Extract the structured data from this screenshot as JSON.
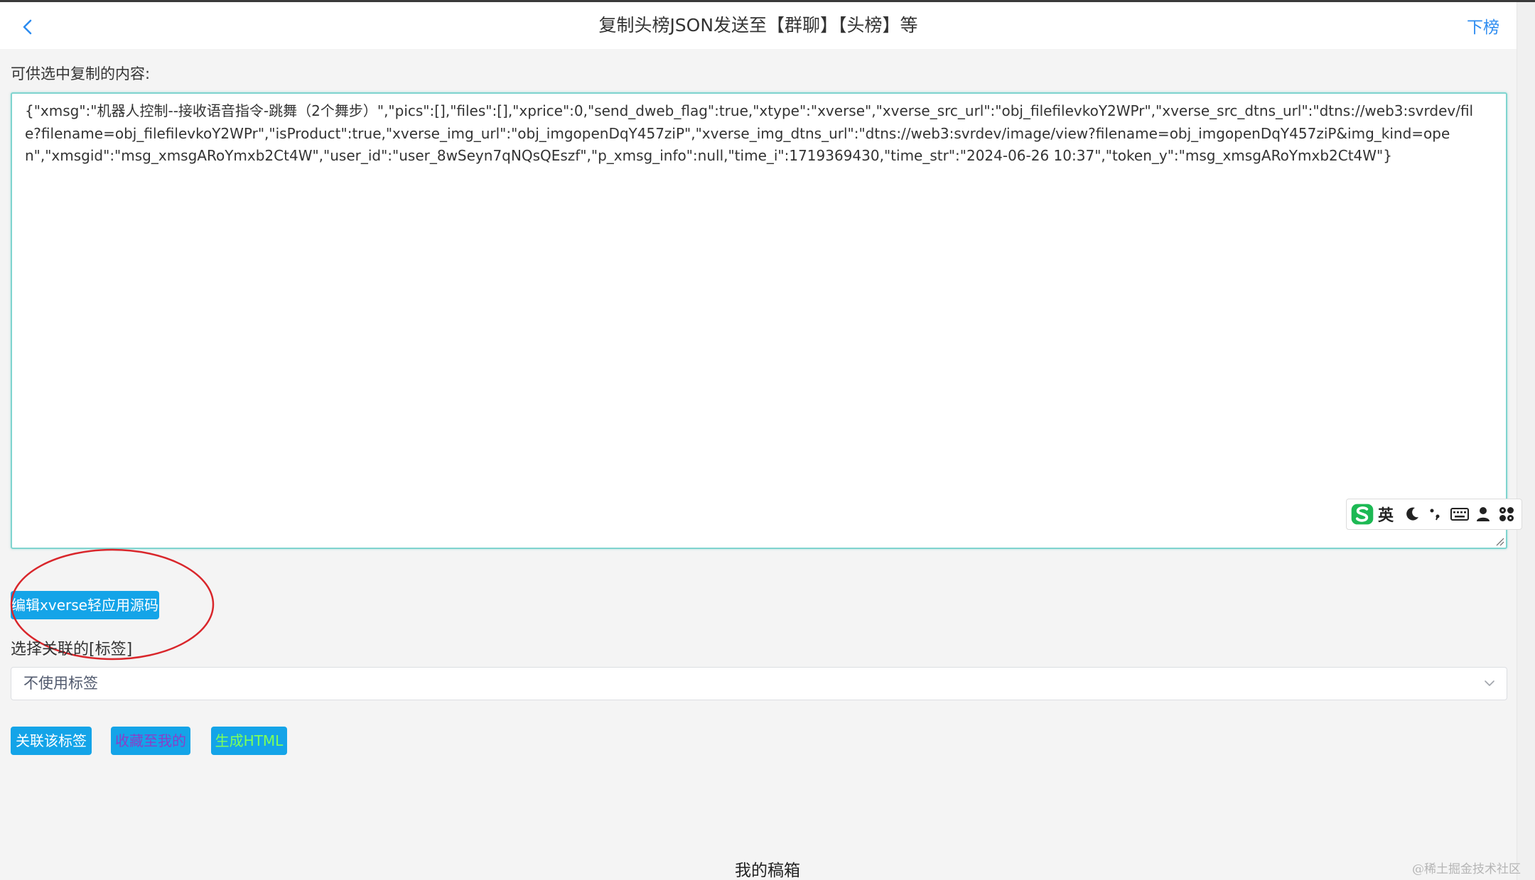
{
  "header": {
    "title": "复制头榜JSON发送至【群聊】【头榜】等",
    "right_action": "下榜",
    "back_icon": "chevron-left-icon"
  },
  "content": {
    "label": "可供选中复制的内容:",
    "json_text": "{\"xmsg\":\"机器人控制--接收语音指令-跳舞（2个舞步）\",\"pics\":[],\"files\":[],\"xprice\":0,\"send_dweb_flag\":true,\"xtype\":\"xverse\",\"xverse_src_url\":\"obj_filefilevkoY2WPr\",\"xverse_src_dtns_url\":\"dtns://web3:svrdev/file?filename=obj_filefilevkoY2WPr\",\"isProduct\":true,\"xverse_img_url\":\"obj_imgopenDqY457ziP\",\"xverse_img_dtns_url\":\"dtns://web3:svrdev/image/view?filename=obj_imgopenDqY457ziP&img_kind=open\",\"xmsgid\":\"msg_xmsgARoYmxb2Ct4W\",\"user_id\":\"user_8wSeyn7qNQsQEszf\",\"p_xmsg_info\":null,\"time_i\":1719369430,\"time_str\":\"2024-06-26 10:37\",\"token_y\":\"msg_xmsgARoYmxb2Ct4W\"}"
  },
  "ime": {
    "lang": "英",
    "logo_icon": "sogou-logo-icon",
    "icons": [
      "moon-icon",
      "punctuation-icon",
      "keyboard-icon",
      "user-icon",
      "grid-menu-icon"
    ]
  },
  "actions": {
    "edit_source_label": "编辑xverse轻应用源码",
    "tag_label": "选择关联的[标签]",
    "tag_select_value": "不使用标签",
    "link_tag_label": "关联该标签",
    "collect_label": "收藏至我的",
    "generate_html_label": "生成HTML"
  },
  "footer": {
    "title": "我的稿箱",
    "watermark": "@稀土掘金技术社区"
  },
  "colors": {
    "accent": "#14a4e8",
    "link": "#2d8cf0",
    "highlight_circle": "#d9262b",
    "textarea_border": "#7fd4cf"
  }
}
